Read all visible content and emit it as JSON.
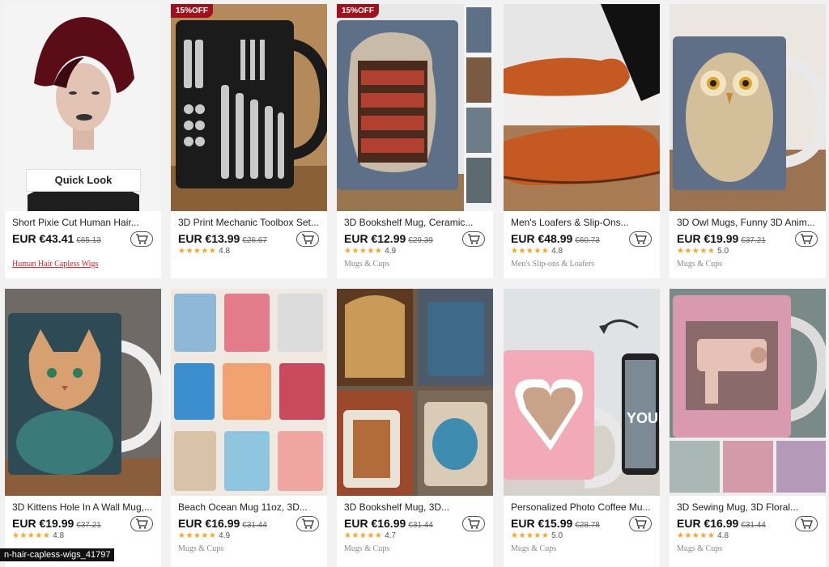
{
  "products": [
    {
      "title": "Short Pixie Cut Human Hair...",
      "price": "EUR €43.41",
      "old_price": "€65.13",
      "stars": "",
      "rating": "",
      "category": "Human Hair Capless Wigs",
      "discount": "",
      "quick_look": "Quick Look"
    },
    {
      "title": "3D Print Mechanic Toolbox Set...",
      "price": "EUR €13.99",
      "old_price": "€26.67",
      "stars": "★★★★★",
      "rating": "4.8",
      "category": "",
      "discount": "15%OFF"
    },
    {
      "title": "3D Bookshelf Mug, Ceramic...",
      "price": "EUR €12.99",
      "old_price": "€29.39",
      "stars": "★★★★★",
      "rating": "4.9",
      "category": "Mugs & Cups",
      "discount": "15%OFF"
    },
    {
      "title": "Men's Loafers & Slip-Ons...",
      "price": "EUR €48.99",
      "old_price": "€60.73",
      "stars": "★★★★★",
      "rating": "4.8",
      "category": "Men's Slip-ons & Loafers",
      "discount": ""
    },
    {
      "title": "3D Owl Mugs, Funny 3D Anim...",
      "price": "EUR €19.99",
      "old_price": "€37.21",
      "stars": "★★★★★",
      "rating": "5.0",
      "category": "Mugs & Cups",
      "discount": ""
    },
    {
      "title": "3D Kittens Hole In A Wall Mug,...",
      "price": "EUR €19.99",
      "old_price": "€37.21",
      "stars": "★★★★★",
      "rating": "4.8",
      "category": "",
      "discount": ""
    },
    {
      "title": "Beach Ocean Mug 11oz, 3D...",
      "price": "EUR €16.99",
      "old_price": "€31.44",
      "stars": "★★★★★",
      "rating": "4.9",
      "category": "Mugs & Cups",
      "discount": ""
    },
    {
      "title": "3D Bookshelf Mug, 3D...",
      "price": "EUR €16.99",
      "old_price": "€31.44",
      "stars": "★★★★★",
      "rating": "4.7",
      "category": "Mugs & Cups",
      "discount": ""
    },
    {
      "title": "Personalized Photo Coffee Mu...",
      "price": "EUR €15.99",
      "old_price": "€28.78",
      "stars": "★★★★★",
      "rating": "5.0",
      "category": "Mugs & Cups",
      "discount": ""
    },
    {
      "title": "3D Sewing Mug, 3D Floral...",
      "price": "EUR €16.99",
      "old_price": "€31.44",
      "stars": "★★★★★",
      "rating": "4.8",
      "category": "Mugs & Cups",
      "discount": ""
    }
  ],
  "image_text": {
    "photo_mug": "YOUR PHOTO"
  },
  "status_tooltip": "n-hair-capless-wigs_41797",
  "colors": {
    "accent": "#a0111e",
    "star": "#f5a623",
    "link": "#dd2222"
  }
}
